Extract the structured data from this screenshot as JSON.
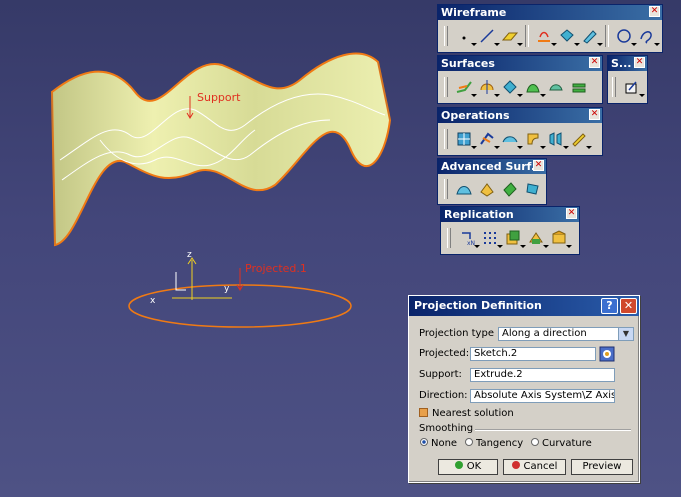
{
  "viewport": {
    "support_label": "Support",
    "projected_label": "Projected.1",
    "axis_x": "x",
    "axis_y": "y",
    "axis_z": "z"
  },
  "toolbars": {
    "wireframe": {
      "title": "Wireframe"
    },
    "surfaces": {
      "title": "Surfaces"
    },
    "s_small": {
      "title": "S..."
    },
    "operations": {
      "title": "Operations"
    },
    "advanced": {
      "title": "Advanced Surf..."
    },
    "replication": {
      "title": "Replication"
    },
    "close_glyph": "✕"
  },
  "dialog": {
    "title": "Projection Definition",
    "help": "?",
    "close": "✕",
    "projection_type_label": "Projection type :",
    "projection_type_value": "Along a direction",
    "projected_label": "Projected:",
    "projected_value": "Sketch.2",
    "support_label": "Support:",
    "support_value": "Extrude.2",
    "direction_label": "Direction:",
    "direction_value": "Absolute Axis System\\Z Axis",
    "nearest_label": "Nearest solution",
    "smoothing_label": "Smoothing",
    "smoothing_options": [
      "None",
      "Tangency",
      "Curvature"
    ],
    "smoothing_selected": "None",
    "ok": "OK",
    "cancel": "Cancel",
    "preview": "Preview"
  },
  "colors": {
    "background": "#3f4374",
    "surface": "#e2e6a0",
    "edge": "#f07a14",
    "curve": "#ffffff",
    "title_bar": "#0a246a",
    "label_red": "#e03020"
  }
}
